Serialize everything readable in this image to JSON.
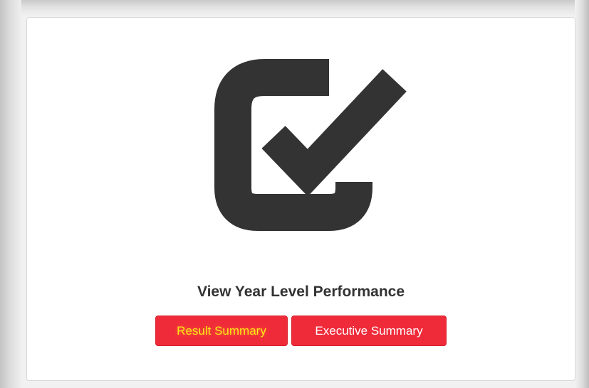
{
  "card": {
    "icon": "checkbox-check-icon",
    "title": "View Year Level Performance",
    "buttons": [
      {
        "label": "Result Summary",
        "text_color": "#ffe81a"
      },
      {
        "label": "Executive Summary",
        "text_color": "#ffffff"
      }
    ]
  },
  "colors": {
    "icon": "#333333",
    "button_bg": "#ef2b3a",
    "title": "#333333"
  }
}
